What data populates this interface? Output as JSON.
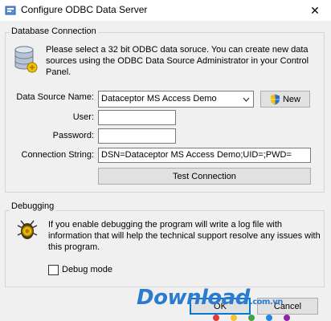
{
  "window": {
    "title": "Configure ODBC Data Server",
    "close_glyph": "✕"
  },
  "database_connection": {
    "group_label": "Database Connection",
    "description": [
      "Please select a 32 bit ODBC data soruce. You can create new data",
      "sources using the ODBC Data Source Administrator in your Control",
      "Panel."
    ],
    "data_source_label": "Data Source Name:",
    "data_source_value": "Dataceptor MS Access Demo",
    "new_button_label": "New",
    "user_label": "User:",
    "user_value": "",
    "password_label": "Password:",
    "password_value": "",
    "connection_string_label": "Connection String:",
    "connection_string_value": "DSN=Dataceptor MS Access Demo;UID=;PWD=",
    "test_button_label": "Test Connection"
  },
  "debugging": {
    "group_label": "Debugging",
    "description": [
      "If you enable debugging the program will write a log file with",
      "information that will help the technical support resolve any issues with",
      "this program."
    ],
    "debug_mode_label": "Debug mode",
    "debug_mode_checked": false
  },
  "footer": {
    "ok_label": "OK",
    "cancel_label": "Cancel"
  },
  "watermark": {
    "text": "Download",
    "suffix": ".com.vn"
  },
  "colors": {
    "accent": "#0078d7",
    "watermark": "#2b7bd1",
    "dots": [
      "#e53935",
      "#fbc02d",
      "#43a047",
      "#1e88e5",
      "#8e24aa"
    ]
  },
  "icons": [
    "odbc-app-icon",
    "database-icon",
    "shield-icon",
    "debug-bug-icon"
  ]
}
